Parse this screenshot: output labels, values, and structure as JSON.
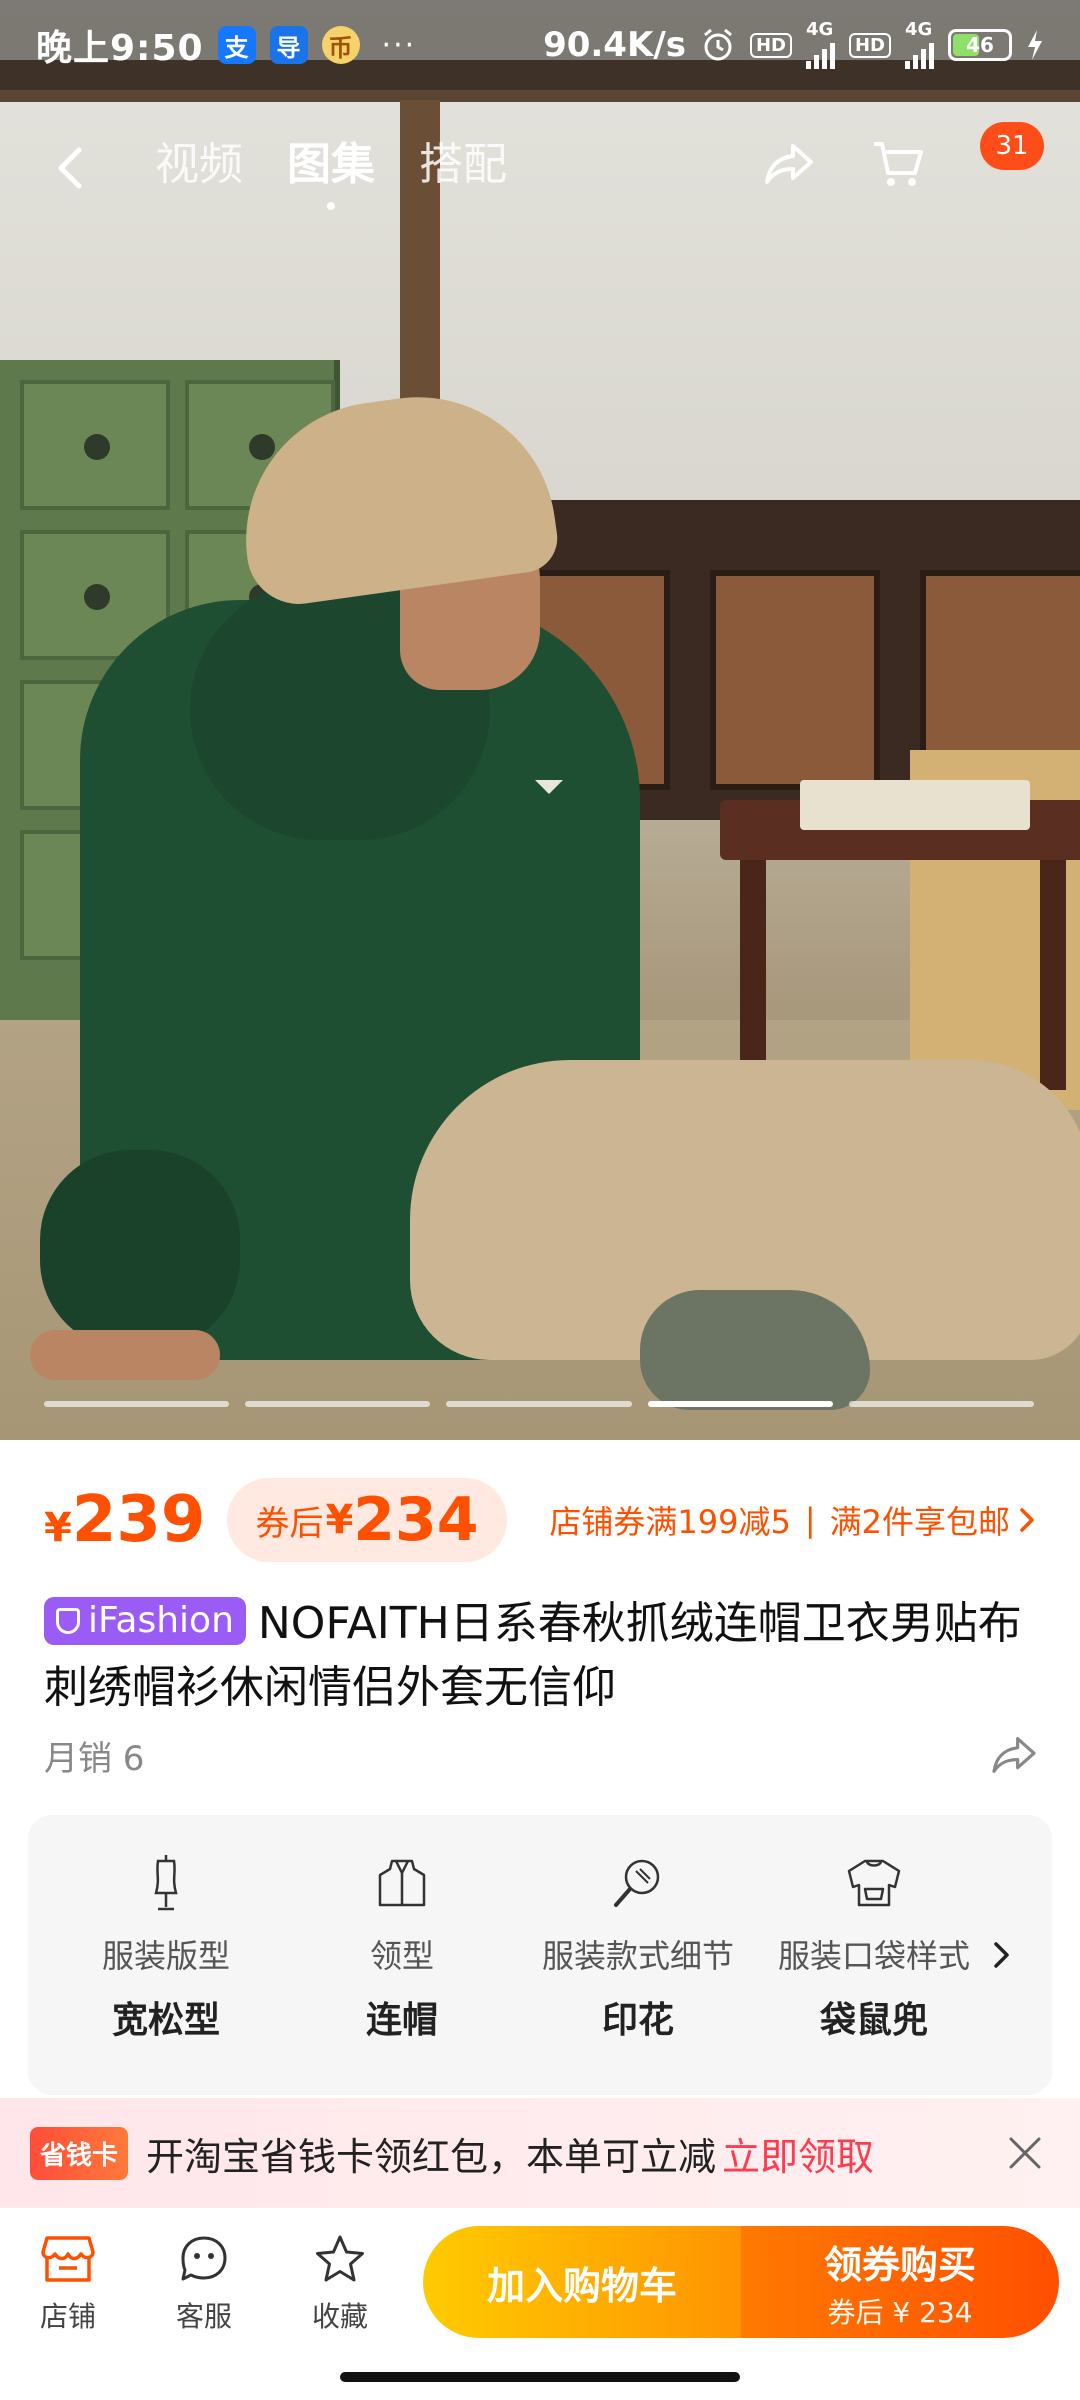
{
  "status_bar": {
    "time": "晚上9:50",
    "apps": [
      "支",
      "导",
      "币"
    ],
    "more": "···",
    "speed": "90.4K/s",
    "hd1": "HD",
    "net1": "4G",
    "hd2": "HD",
    "net2": "4G",
    "battery": "46"
  },
  "nav": {
    "tabs": [
      {
        "label": "视频",
        "active": false
      },
      {
        "label": "图集",
        "active": true
      },
      {
        "label": "搭配",
        "active": false
      }
    ],
    "cart_badge": "31"
  },
  "gallery": {
    "count": 5,
    "active_index": 3
  },
  "price": {
    "currency": "¥",
    "value": "239",
    "coupon_label": "券后",
    "coupon_currency": "¥",
    "coupon_value": "234",
    "promo_left": "店铺券满199减5",
    "promo_sep": "|",
    "promo_right": "满2件享包邮"
  },
  "title": {
    "badge": "iFashion",
    "text": "NOFAITH日系春秋抓绒连帽卫衣男贴布刺绣帽衫休闲情侣外套无信仰"
  },
  "sales": "月销 6",
  "attributes": [
    {
      "icon": "dress-form-icon",
      "name": "服装版型",
      "value": "宽松型"
    },
    {
      "icon": "collar-icon",
      "name": "领型",
      "value": "连帽"
    },
    {
      "icon": "magnifier-icon",
      "name": "服装款式细节",
      "value": "印花"
    },
    {
      "icon": "shirt-icon",
      "name": "服装口袋样式",
      "value": "袋鼠兜"
    }
  ],
  "banner": {
    "tag": "省钱卡",
    "text": "开淘宝省钱卡领红包，本单可立减",
    "link": "立即领取"
  },
  "bottom_bar": {
    "store": "店铺",
    "service": "客服",
    "favorite": "收藏",
    "add_cart": "加入购物车",
    "buy": "领券购买",
    "buy_sub": "券后 ¥ 234"
  },
  "colors": {
    "accent": "#ff5000",
    "brand_badge": "#9b5cf6",
    "banner_link": "#ff3b4e"
  }
}
